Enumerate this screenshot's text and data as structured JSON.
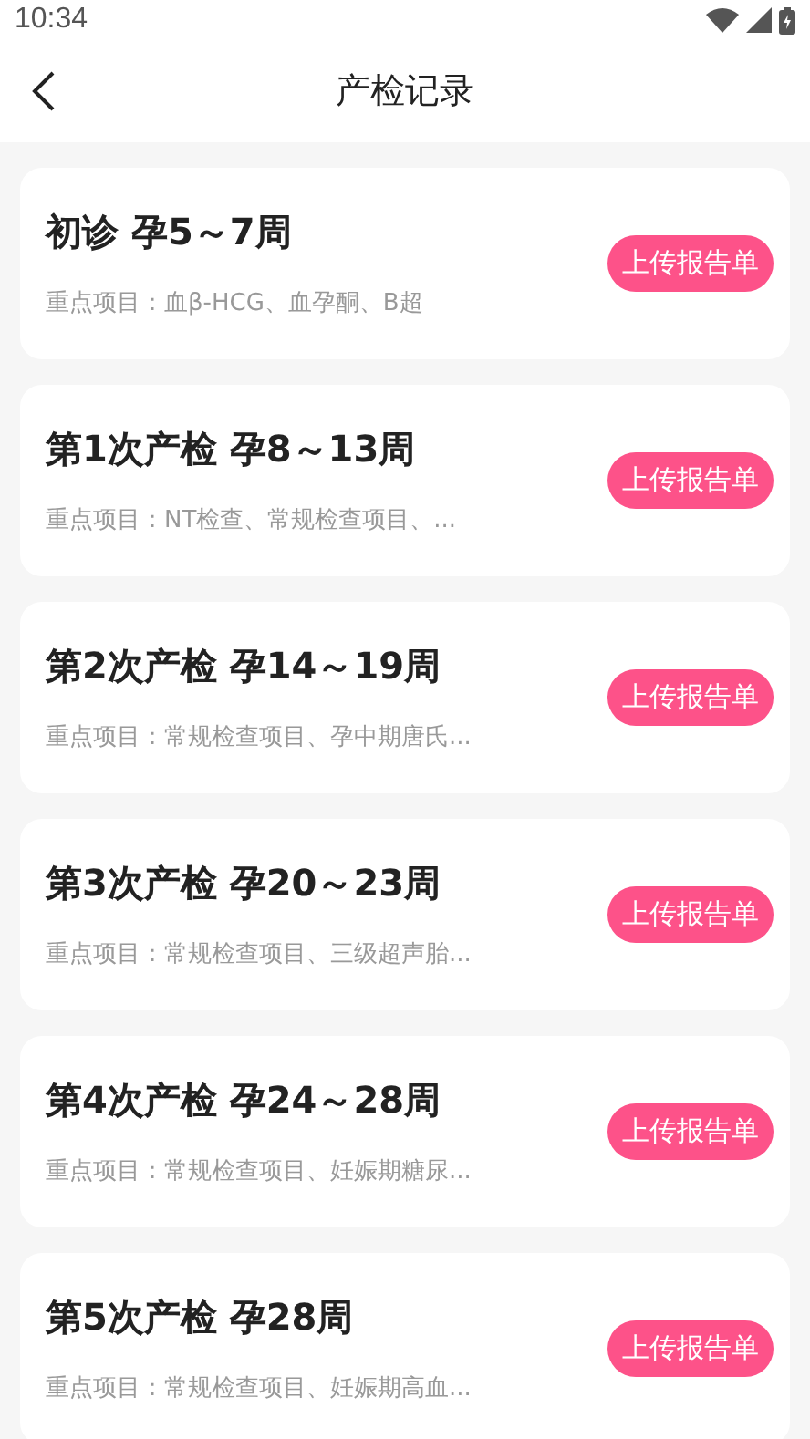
{
  "status_bar": {
    "time": "10:34"
  },
  "header": {
    "title": "产检记录"
  },
  "records": [
    {
      "title": "初诊 孕5～7周",
      "items": "重点项目：血β-HCG、血孕酮、B超",
      "button": "上传报告单"
    },
    {
      "title": "第1次产检 孕8～13周",
      "items": "重点项目：NT检查、常规检查项目、...",
      "button": "上传报告单"
    },
    {
      "title": "第2次产检 孕14～19周",
      "items": "重点项目：常规检查项目、孕中期唐氏...",
      "button": "上传报告单"
    },
    {
      "title": "第3次产检 孕20～23周",
      "items": "重点项目：常规检查项目、三级超声胎...",
      "button": "上传报告单"
    },
    {
      "title": "第4次产检 孕24～28周",
      "items": "重点项目：常规检查项目、妊娠期糖尿...",
      "button": "上传报告单"
    },
    {
      "title": "第5次产检 孕28周",
      "items": "重点项目：常规检查项目、妊娠期高血...",
      "button": "上传报告单"
    }
  ]
}
